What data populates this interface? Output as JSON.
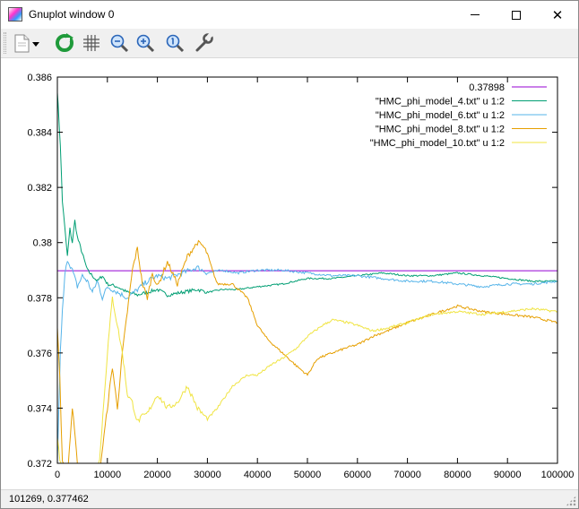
{
  "window": {
    "title": "Gnuplot window 0",
    "close_glyph": "✕"
  },
  "toolbar": {
    "buttons": [
      {
        "name": "copy-print-icon",
        "label": "Copy / print menu"
      },
      {
        "name": "replot-icon",
        "label": "Replot"
      },
      {
        "name": "grid-icon",
        "label": "Toggle grid"
      },
      {
        "name": "zoom-out-icon",
        "label": "Previous zoom"
      },
      {
        "name": "zoom-in-icon",
        "label": "Next zoom"
      },
      {
        "name": "zoom-reset-icon",
        "label": "Autoscale"
      },
      {
        "name": "settings-wrench-icon",
        "label": "Options"
      }
    ]
  },
  "status": {
    "coords": "101269,  0.377462"
  },
  "colors": {
    "axis": "#000000",
    "series_const": "#9400d3",
    "series_4": "#009e73",
    "series_6": "#56b4e9",
    "series_8": "#e69f00",
    "series_10": "#f0e442"
  },
  "chart_data": {
    "type": "line",
    "title": "",
    "xlabel": "",
    "ylabel": "",
    "xlim": [
      0,
      100000
    ],
    "ylim": [
      0.372,
      0.386
    ],
    "xticks": [
      "0",
      "10000",
      "20000",
      "30000",
      "40000",
      "50000",
      "60000",
      "70000",
      "80000",
      "90000",
      "100000"
    ],
    "yticks": [
      "0.372",
      "0.374",
      "0.376",
      "0.378",
      "0.38",
      "0.382",
      "0.384",
      "0.386"
    ],
    "grid": false,
    "legend_position": "top-right",
    "series": [
      {
        "name": "0.37898",
        "color": "#9400d3",
        "x": [
          0,
          100000
        ],
        "y": [
          0.37898,
          0.37898
        ]
      },
      {
        "name": "\"HMC_phi_model_4.txt\" u 1:2",
        "color": "#009e73",
        "x": [
          0,
          300,
          600,
          1000,
          1500,
          2000,
          2500,
          3000,
          3500,
          4000,
          5000,
          6000,
          7000,
          8000,
          9000,
          10000,
          12000,
          14000,
          16000,
          18000,
          20000,
          22000,
          25000,
          28000,
          30000,
          33000,
          36000,
          40000,
          45000,
          50000,
          55000,
          60000,
          65000,
          70000,
          75000,
          80000,
          85000,
          90000,
          95000,
          100000
        ],
        "y": [
          0.3855,
          0.3845,
          0.3835,
          0.3815,
          0.3805,
          0.3795,
          0.3805,
          0.38,
          0.3808,
          0.3802,
          0.3796,
          0.379,
          0.3788,
          0.3786,
          0.3788,
          0.3785,
          0.3784,
          0.3782,
          0.3781,
          0.3782,
          0.3783,
          0.3781,
          0.3782,
          0.3783,
          0.3782,
          0.3783,
          0.3783,
          0.3784,
          0.3785,
          0.3787,
          0.3787,
          0.3788,
          0.3789,
          0.3788,
          0.3788,
          0.3789,
          0.3788,
          0.3787,
          0.3786,
          0.3786
        ]
      },
      {
        "name": "\"HMC_phi_model_6.txt\" u 1:2",
        "color": "#56b4e9",
        "x": [
          0,
          300,
          600,
          1000,
          1500,
          2000,
          3000,
          4000,
          5000,
          6000,
          7000,
          8000,
          9000,
          10000,
          12000,
          14000,
          16000,
          18000,
          20000,
          22000,
          25000,
          28000,
          30000,
          33000,
          36000,
          40000,
          45000,
          50000,
          55000,
          60000,
          65000,
          70000,
          75000,
          80000,
          85000,
          90000,
          95000,
          100000
        ],
        "y": [
          0.372,
          0.374,
          0.376,
          0.3775,
          0.3788,
          0.3794,
          0.379,
          0.3784,
          0.3788,
          0.3786,
          0.3782,
          0.3786,
          0.378,
          0.3784,
          0.3782,
          0.378,
          0.3783,
          0.3786,
          0.3788,
          0.3787,
          0.3789,
          0.3791,
          0.3789,
          0.379,
          0.3789,
          0.379,
          0.379,
          0.3789,
          0.3788,
          0.3788,
          0.3787,
          0.3786,
          0.3786,
          0.3785,
          0.3784,
          0.3785,
          0.3785,
          0.3786
        ]
      },
      {
        "name": "\"HMC_phi_model_8.txt\" u 1:2",
        "color": "#e69f00",
        "x": [
          0,
          500,
          1000,
          2000,
          3000,
          4000,
          5000,
          6000,
          8000,
          10000,
          11000,
          12000,
          13000,
          14000,
          15000,
          16000,
          17000,
          18000,
          19000,
          20000,
          22000,
          24000,
          26000,
          28000,
          29000,
          30000,
          31000,
          32000,
          35000,
          38000,
          40000,
          42000,
          45000,
          48000,
          50000,
          52000,
          55000,
          58000,
          60000,
          63000,
          66000,
          70000,
          75000,
          80000,
          85000,
          90000,
          95000,
          100000
        ],
        "y": [
          0.377,
          0.375,
          0.372,
          0.3715,
          0.374,
          0.372,
          0.37,
          0.368,
          0.371,
          0.374,
          0.3755,
          0.374,
          0.376,
          0.3775,
          0.379,
          0.3798,
          0.3785,
          0.378,
          0.3789,
          0.3784,
          0.3793,
          0.3785,
          0.3795,
          0.38,
          0.3799,
          0.3796,
          0.379,
          0.3785,
          0.3785,
          0.378,
          0.377,
          0.3765,
          0.376,
          0.3755,
          0.3752,
          0.3758,
          0.376,
          0.3762,
          0.3763,
          0.3766,
          0.3768,
          0.3771,
          0.3774,
          0.3777,
          0.3775,
          0.3774,
          0.3773,
          0.3771
        ]
      },
      {
        "name": "\"HMC_phi_model_10.txt\" u 1:2",
        "color": "#f0e442",
        "x": [
          0,
          500,
          1000,
          2000,
          3000,
          4000,
          5000,
          6000,
          8000,
          10000,
          11000,
          12000,
          13000,
          14000,
          15000,
          16000,
          17000,
          18000,
          20000,
          22000,
          24000,
          26000,
          28000,
          30000,
          32000,
          35000,
          38000,
          40000,
          43000,
          45000,
          48000,
          50000,
          53000,
          55000,
          58000,
          60000,
          63000,
          66000,
          70000,
          75000,
          80000,
          85000,
          90000,
          95000,
          100000
        ],
        "y": [
          0.373,
          0.372,
          0.3715,
          0.3718,
          0.3714,
          0.3712,
          0.3705,
          0.37,
          0.371,
          0.376,
          0.378,
          0.377,
          0.376,
          0.3745,
          0.3742,
          0.3735,
          0.3737,
          0.3738,
          0.3745,
          0.374,
          0.3742,
          0.3748,
          0.374,
          0.3736,
          0.374,
          0.3748,
          0.3752,
          0.3752,
          0.3756,
          0.3758,
          0.3762,
          0.3766,
          0.377,
          0.3772,
          0.3771,
          0.377,
          0.3768,
          0.3769,
          0.3771,
          0.3774,
          0.3775,
          0.3774,
          0.3775,
          0.3776,
          0.3775
        ]
      }
    ]
  }
}
